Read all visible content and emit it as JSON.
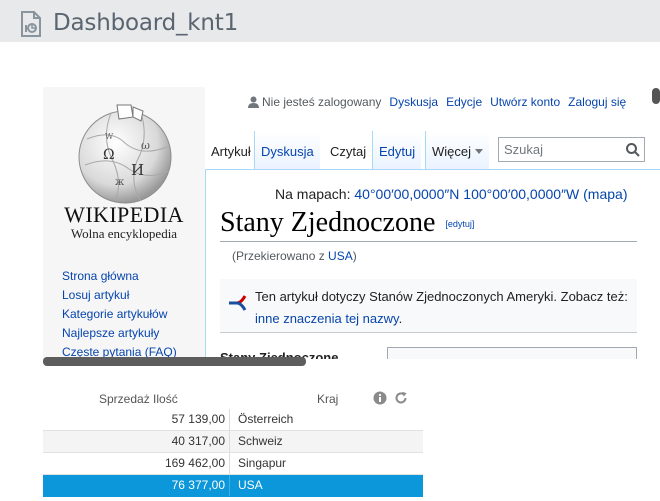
{
  "header": {
    "title": "Dashboard_knt1",
    "icon": "report-document-icon"
  },
  "wiki": {
    "logo": {
      "wordmark": "WIKIPEDIA",
      "tagline": "Wolna encyklopedia"
    },
    "nav": [
      "Strona główna",
      "Losuj artykuł",
      "Kategorie artykułów",
      "Najlepsze artykuły",
      "Częste pytania (FAQ)"
    ],
    "personal": {
      "not_logged": "Nie jesteś zalogowany",
      "links": [
        "Dyskusja",
        "Edycje",
        "Utwórz konto",
        "Zaloguj się"
      ]
    },
    "tabs": {
      "article": "Artykuł",
      "talk": "Dyskusja",
      "read": "Czytaj",
      "edit": "Edytuj",
      "more": "Więcej"
    },
    "search": {
      "placeholder": "Szukaj"
    },
    "coords": {
      "label": "Na mapach:",
      "value": "40°00′00,0000″N 100°00′00,0000″W",
      "map_link": "(mapa)"
    },
    "title": "Stany Zjednoczone",
    "edit_link": "[edytuj]",
    "redirect": {
      "prefix": "(Przekierowano z ",
      "link": "USA",
      "suffix": ")"
    },
    "hatnote": {
      "text": "Ten artykuł dotyczy Stanów Zjednoczonych Ameryki. Zobacz też: ",
      "link": "inne znaczenia tej nazwy",
      "suffix": "."
    },
    "lead": "Stany Zjednoczone"
  },
  "table": {
    "headers": {
      "amount": "Sprzedaż Ilość",
      "country": "Kraj"
    },
    "rows": [
      {
        "amount": "57 139,00",
        "country": "Österreich",
        "selected": false
      },
      {
        "amount": "40 317,00",
        "country": "Schweiz",
        "selected": false
      },
      {
        "amount": "169 462,00",
        "country": "Singapur",
        "selected": false
      },
      {
        "amount": "76 377,00",
        "country": "USA",
        "selected": true
      }
    ]
  },
  "colors": {
    "link": "#0645ad",
    "selected_row": "#0b97d9",
    "header_bg": "#e7e9eb"
  }
}
